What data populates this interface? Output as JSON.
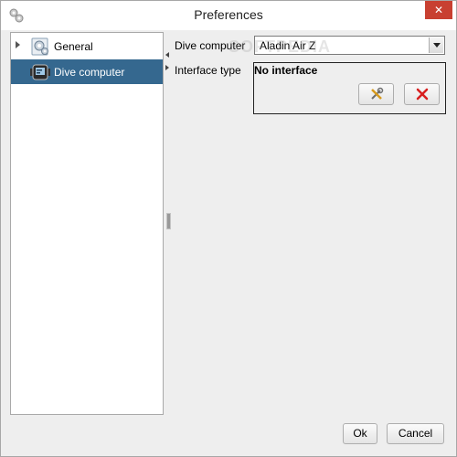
{
  "window": {
    "title": "Preferences",
    "close_label": "✕"
  },
  "sidebar": {
    "items": [
      {
        "label": "General",
        "icon": "gear-icon",
        "expandable": true,
        "selected": false
      },
      {
        "label": "Dive computer",
        "icon": "dive-computer-icon",
        "expandable": false,
        "selected": true
      }
    ]
  },
  "form": {
    "dive_computer_label": "Dive computer",
    "dive_computer_value": "Aladin Air Z",
    "interface_type_label": "Interface type",
    "interface_type_value": "No interface"
  },
  "buttons": {
    "ok": "Ok",
    "cancel": "Cancel"
  },
  "colors": {
    "selection": "#35688f",
    "close": "#c84031",
    "remove_icon": "#d81e1e"
  },
  "watermark": "SOFTPEDIA"
}
